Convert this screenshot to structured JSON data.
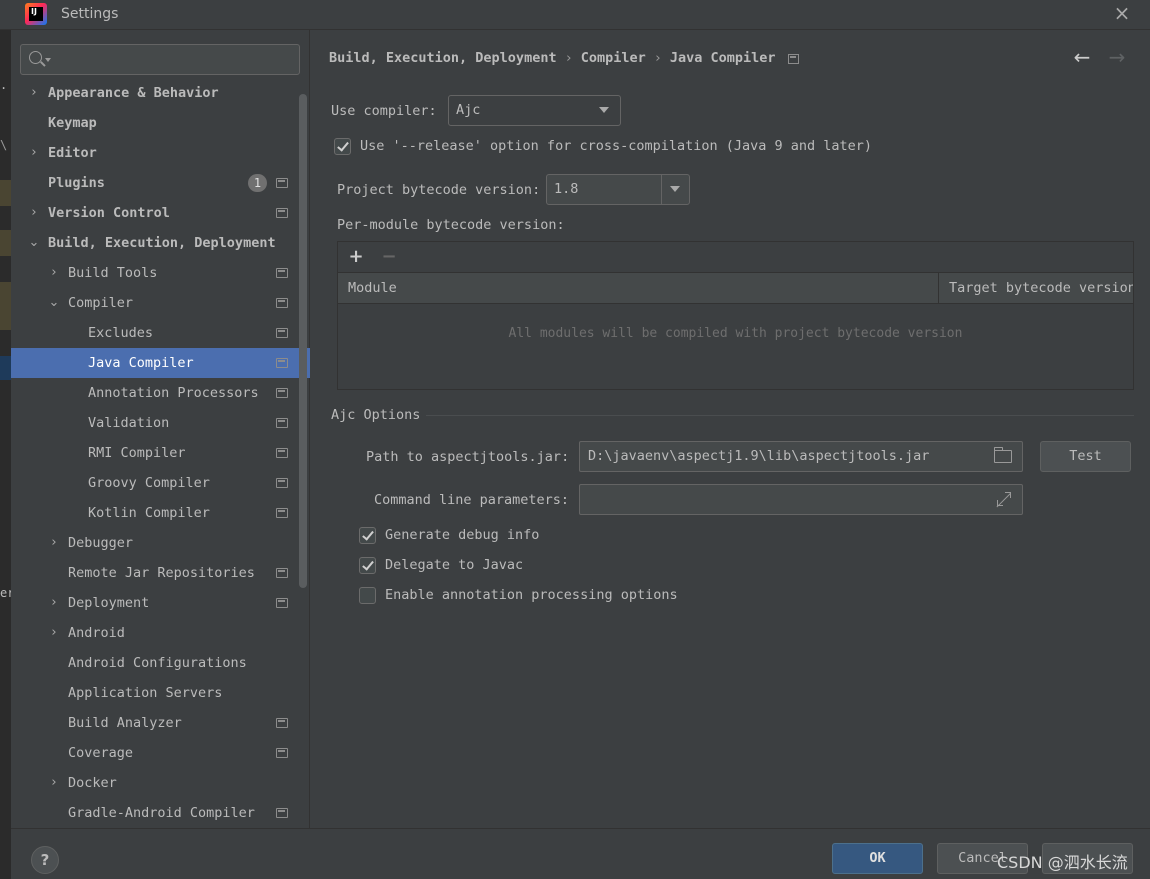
{
  "window": {
    "title": "Settings",
    "app_icon_text": "IJ"
  },
  "ide_strip": {
    "t1": ".",
    "t2": "\\",
    "t3": "er"
  },
  "search": {
    "placeholder": ""
  },
  "sidebar": {
    "items": [
      {
        "label": "Appearance & Behavior",
        "arrow": "›",
        "bold": true
      },
      {
        "label": "Keymap",
        "bold": true
      },
      {
        "label": "Editor",
        "arrow": "›",
        "bold": true
      },
      {
        "label": "Plugins",
        "bold": true,
        "badge": "1"
      },
      {
        "label": "Version Control",
        "arrow": "›",
        "bold": true
      },
      {
        "label": "Build, Execution, Deployment",
        "arrow": "⌄",
        "bold": true
      },
      {
        "label": "Build Tools",
        "arrow": "›"
      },
      {
        "label": "Compiler",
        "arrow": "⌄"
      },
      {
        "label": "Excludes"
      },
      {
        "label": "Java Compiler",
        "selected": true
      },
      {
        "label": "Annotation Processors"
      },
      {
        "label": "Validation"
      },
      {
        "label": "RMI Compiler"
      },
      {
        "label": "Groovy Compiler"
      },
      {
        "label": "Kotlin Compiler"
      },
      {
        "label": "Debugger",
        "arrow": "›"
      },
      {
        "label": "Remote Jar Repositories"
      },
      {
        "label": "Deployment",
        "arrow": "›"
      },
      {
        "label": "Android",
        "arrow": "›"
      },
      {
        "label": "Android Configurations"
      },
      {
        "label": "Application Servers"
      },
      {
        "label": "Build Analyzer"
      },
      {
        "label": "Coverage"
      },
      {
        "label": "Docker",
        "arrow": "›"
      },
      {
        "label": "Gradle-Android Compiler"
      }
    ]
  },
  "breadcrumb": [
    "Build, Execution, Deployment",
    "Compiler",
    "Java Compiler"
  ],
  "breadcrumb_sep": "›",
  "nav": {
    "back": "←",
    "forward": "→"
  },
  "compiler": {
    "use_compiler_label": "Use compiler:",
    "use_compiler_value": "Ajc",
    "release_option_label": "Use '--release' option for cross-compilation (Java 9 and later)",
    "release_option_checked": true,
    "bytecode_label": "Project bytecode version:",
    "bytecode_value": "1.8",
    "per_module_label": "Per-module bytecode version:"
  },
  "module_table": {
    "add": "+",
    "remove": "−",
    "columns": [
      "Module",
      "Target bytecode version"
    ],
    "empty_text": "All modules will be compiled with project bytecode version"
  },
  "ajc": {
    "section_title": "Ajc Options",
    "path_label": "Path to aspectjtools.jar:",
    "path_value": "D:\\javaenv\\aspectj1.9\\lib\\aspectjtools.jar",
    "test_button": "Test",
    "cmd_label": "Command line parameters:",
    "cmd_value": "",
    "debug_info_label": "Generate debug info",
    "debug_info_checked": true,
    "delegate_label": "Delegate to Javac",
    "delegate_checked": true,
    "annotation_label": "Enable annotation processing options",
    "annotation_checked": false
  },
  "footer": {
    "help": "?",
    "ok": "OK",
    "cancel": "Cancel",
    "watermark": "CSDN @泗水长流"
  }
}
